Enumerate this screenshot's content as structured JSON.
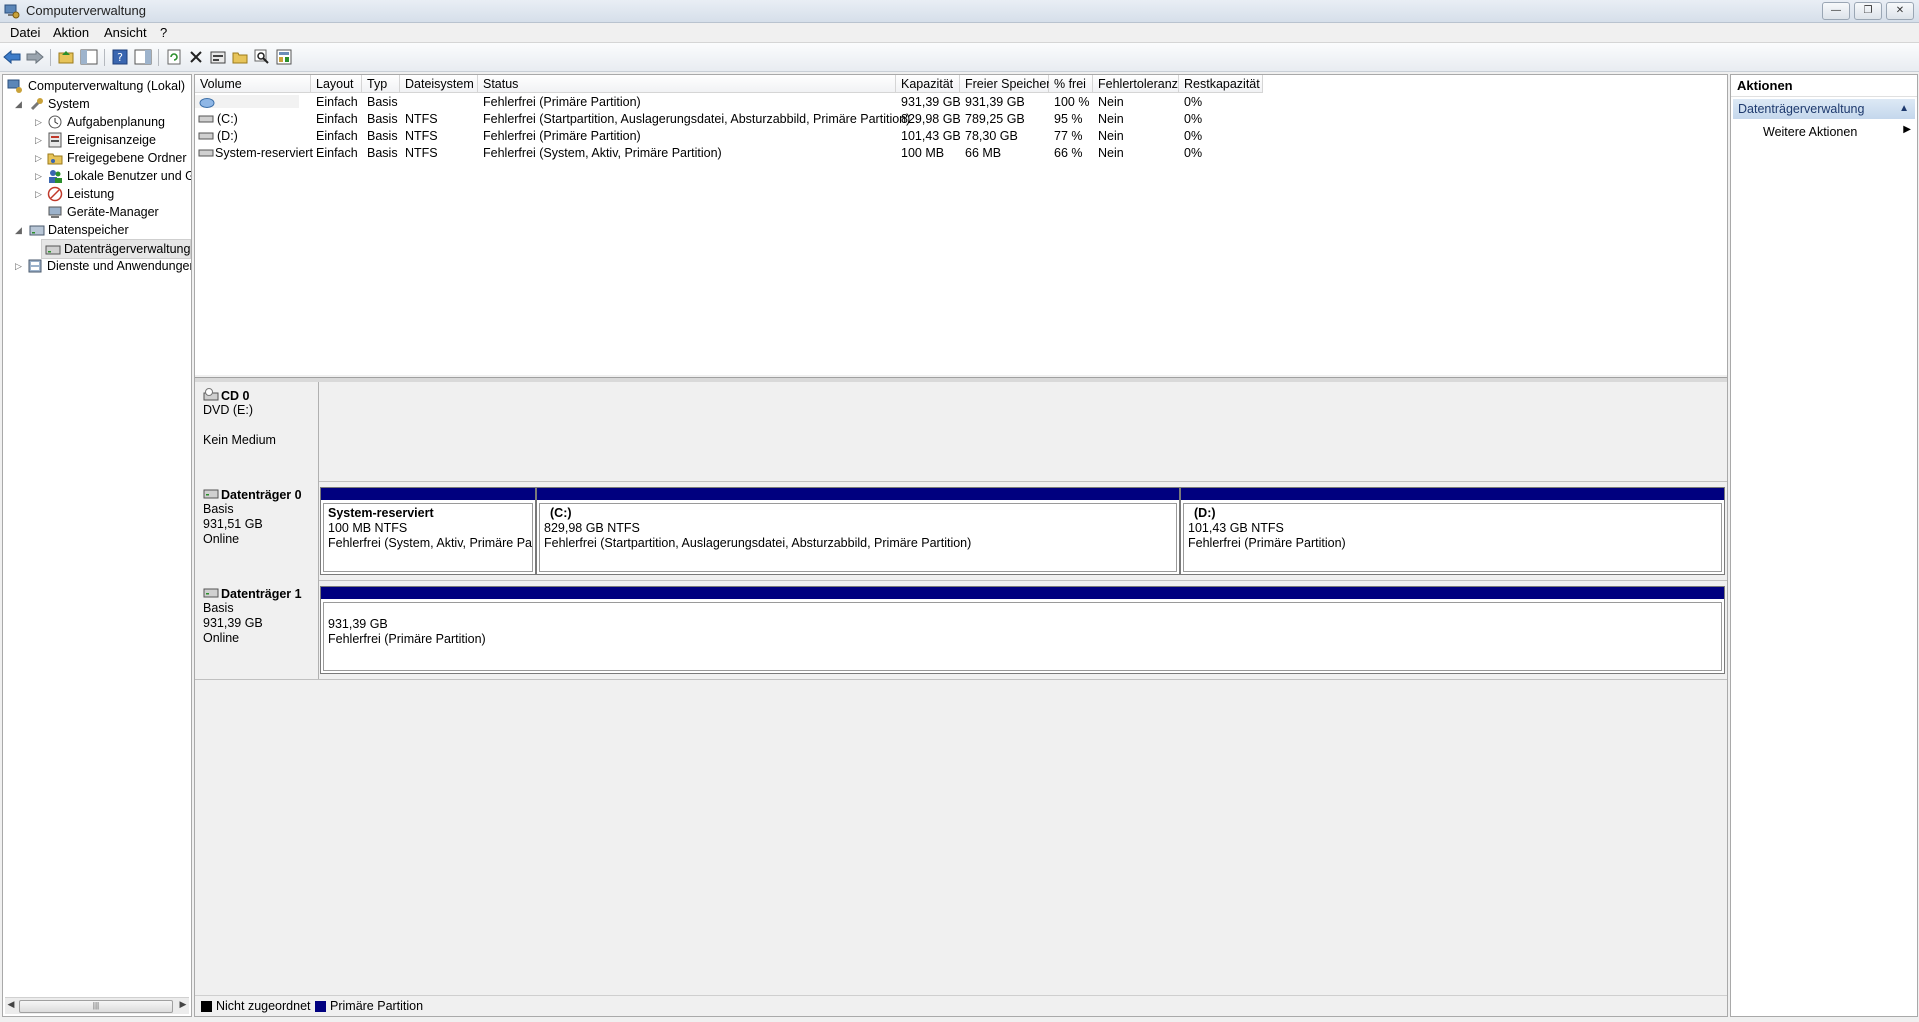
{
  "window": {
    "title": "Computerverwaltung"
  },
  "menu": [
    "Datei",
    "Aktion",
    "Ansicht",
    "?"
  ],
  "toolbar": {
    "buttons": [
      "back-icon",
      "forward-icon",
      "up-folder-icon",
      "show-hide-tree-icon",
      "help-icon",
      "show-hide-action-pane-icon",
      "refresh-icon",
      "delete-icon",
      "properties-icon",
      "open-icon",
      "search-icon",
      "settings-icon"
    ]
  },
  "tree": {
    "items": [
      {
        "label": "Computerverwaltung (Lokal)"
      },
      {
        "label": "System"
      },
      {
        "label": "Aufgabenplanung"
      },
      {
        "label": "Ereignisanzeige"
      },
      {
        "label": "Freigegebene Ordner"
      },
      {
        "label": "Lokale Benutzer und Gr"
      },
      {
        "label": "Leistung"
      },
      {
        "label": "Geräte-Manager"
      },
      {
        "label": "Datenspeicher"
      },
      {
        "label": "Datenträgerverwaltung"
      },
      {
        "label": "Dienste und Anwendungen"
      }
    ],
    "scroll_grip": "|||"
  },
  "volumes": {
    "columns": [
      "Volume",
      "Layout",
      "Typ",
      "Dateisystem",
      "Status",
      "Kapazität",
      "Freier Speicher",
      "% frei",
      "Fehlertoleranz",
      "Restkapazität"
    ],
    "rows": [
      [
        "",
        "Einfach",
        "Basis",
        "",
        "Fehlerfrei (Primäre Partition)",
        "931,39 GB",
        "931,39 GB",
        "100 %",
        "Nein",
        "0%"
      ],
      [
        "(C:)",
        "Einfach",
        "Basis",
        "NTFS",
        "Fehlerfrei (Startpartition, Auslagerungsdatei, Absturzabbild, Primäre Partition)",
        "829,98 GB",
        "789,25 GB",
        "95 %",
        "Nein",
        "0%"
      ],
      [
        "(D:)",
        "Einfach",
        "Basis",
        "NTFS",
        "Fehlerfrei (Primäre Partition)",
        "101,43 GB",
        "78,30 GB",
        "77 %",
        "Nein",
        "0%"
      ],
      [
        "System-reserviert",
        "Einfach",
        "Basis",
        "NTFS",
        "Fehlerfrei (System, Aktiv, Primäre Partition)",
        "100 MB",
        "66 MB",
        "66 %",
        "Nein",
        "0%"
      ]
    ]
  },
  "disks": {
    "cd0": {
      "name": "CD 0",
      "type": "DVD (E:)",
      "status": "Kein Medium"
    },
    "disk0": {
      "name": "Datenträger 0",
      "type": "Basis",
      "size": "931,51 GB",
      "status": "Online",
      "partitions": [
        {
          "name": "System-reserviert",
          "size": "100 MB NTFS",
          "status": "Fehlerfrei (System, Aktiv, Primäre Parti"
        },
        {
          "name": "(C:)",
          "size": "829,98 GB NTFS",
          "status": "Fehlerfrei (Startpartition, Auslagerungsdatei, Absturzabbild, Primäre Partition)"
        },
        {
          "name": "(D:)",
          "size": "101,43 GB NTFS",
          "status": "Fehlerfrei (Primäre Partition)"
        }
      ]
    },
    "disk1": {
      "name": "Datenträger 1",
      "type": "Basis",
      "size": "931,39 GB",
      "status": "Online",
      "partitions": [
        {
          "size": "931,39 GB",
          "status": "Fehlerfrei (Primäre Partition)"
        }
      ]
    }
  },
  "legend": [
    {
      "label": "Nicht zugeordnet",
      "color": "#000000"
    },
    {
      "label": "Primäre Partition",
      "color": "#00007f"
    }
  ],
  "actions": {
    "header": "Aktionen",
    "section": "Datenträgerverwaltung",
    "items": [
      "Weitere Aktionen"
    ]
  },
  "colors": {
    "primary_partition": "#00007f",
    "action_section": "#c4d7ec"
  }
}
